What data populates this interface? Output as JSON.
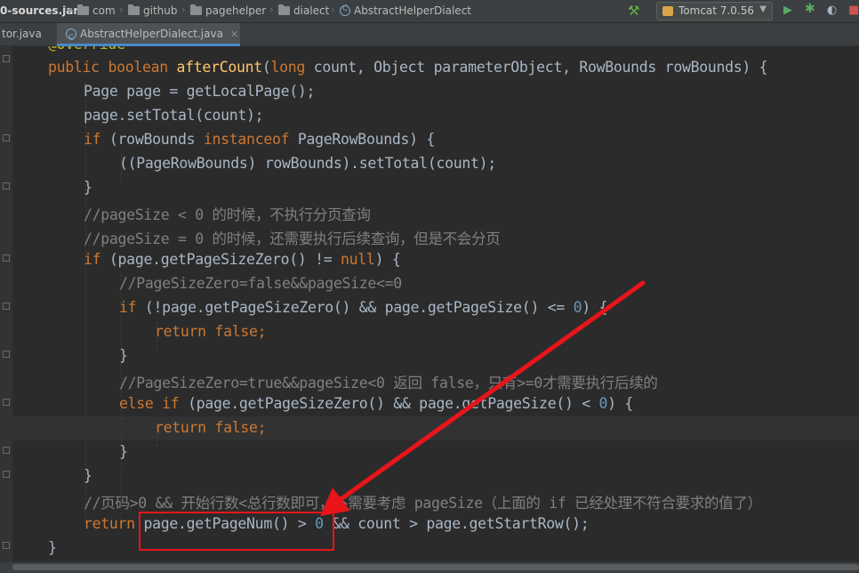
{
  "breadcrumbs": {
    "jar": "0-sources.jar",
    "items": [
      "com",
      "github",
      "pagehelper",
      "dialect"
    ],
    "current_class": "AbstractHelperDialect"
  },
  "toolbar": {
    "run_config": "Tomcat 7.0.56",
    "icons": [
      "hammer-icon",
      "tomcat-icon",
      "chevron-down-icon",
      "run-icon",
      "debug-icon",
      "coverage-icon",
      "stop-icon"
    ]
  },
  "tabs": [
    {
      "label": "tor.java",
      "active": false
    },
    {
      "label": "AbstractHelperDialect.java",
      "active": true
    }
  ],
  "code": {
    "line0": "@Override",
    "l1": {
      "kw1": "public",
      "kw2": "boolean",
      "fn": "afterCount",
      "p1": "(",
      "kw3": "long",
      "rest": " count, Object parameterObject, RowBounds rowBounds) {"
    },
    "l2": "Page page = getLocalPage();",
    "l3": "page.setTotal(count);",
    "l4": {
      "kw": "if",
      "a": " (rowBounds ",
      "kw2": "instanceof",
      "b": " PageRowBounds) {"
    },
    "l5": "((PageRowBounds) rowBounds).setTotal(count);",
    "l6": "}",
    "l7": "//pageSize < 0 的时候，不执行分页查询",
    "l8": "//pageSize = 0 的时候，还需要执行后续查询，但是不会分页",
    "l9": {
      "kw": "if",
      "a": " (page.getPageSizeZero() != ",
      "kw2": "null",
      "b": ") {"
    },
    "l10": "//PageSizeZero=false&&pageSize<=0",
    "l11": {
      "kw": "if",
      "a": " (!page.getPageSizeZero() && page.getPageSize() <= ",
      "num": "0",
      "b": ") {"
    },
    "l12": {
      "kw": "return",
      "kw2": "false",
      "b": ";"
    },
    "l13": "}",
    "l14": "//PageSizeZero=true&&pageSize<0 返回 false，只有>=0才需要执行后续的",
    "l15": {
      "kw": "else if",
      "a": " (page.getPageSizeZero() && page.getPageSize() < ",
      "num": "0",
      "b": ") {"
    },
    "l16": {
      "kw": "return",
      "kw2": "false",
      "b": ";"
    },
    "l17": "}",
    "l18": "}",
    "l19": "//页码>0 && 开始行数<总行数即可，不需要考虑 pageSize（上面的 if 已经处理不符合要求的值了）",
    "l20": {
      "kw": "return",
      "a": " page.getPageNum() > ",
      "num": "0",
      "b": " && count > page.getStartRow();"
    },
    "l21": "}"
  },
  "annotation": {
    "box_color": "#E8151A",
    "arrow_color": "#E8151A"
  }
}
